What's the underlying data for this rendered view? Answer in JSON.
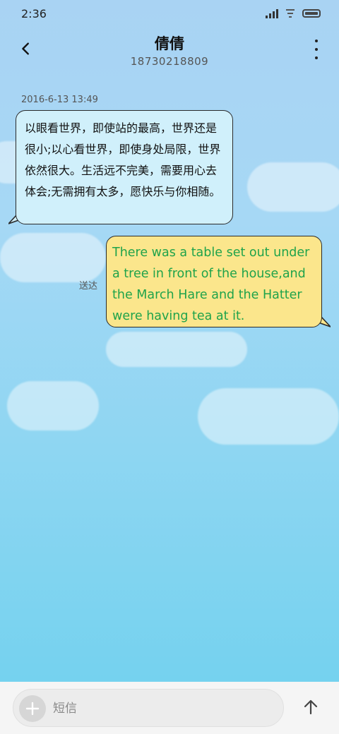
{
  "status_bar": {
    "time": "2:36"
  },
  "header": {
    "contact_name": "倩倩",
    "contact_number": "18730218809"
  },
  "conversation": {
    "timestamp": "2016-6-13 13:49",
    "incoming_message": "以眼看世界，即使站的最高，世界还是很小;以心看世界，即使身处局限，世界依然很大。生活远不完美，需要用心去体会;无需拥有太多，愿快乐与你相随。",
    "outgoing_message": "There was a table set out under a tree in front of the house,and the March Hare and the Hatter were having tea at it.",
    "outgoing_status": "送达"
  },
  "composer": {
    "placeholder": "短信"
  },
  "colors": {
    "incoming_bubble": "#d0f0fb",
    "outgoing_bubble": "#fbe68c",
    "outgoing_text": "#1fa34b"
  },
  "icons": [
    "back-arrow-icon",
    "more-vertical-icon",
    "plus-icon",
    "send-arrow-icon",
    "signal-icon",
    "wifi-icon",
    "battery-icon"
  ]
}
